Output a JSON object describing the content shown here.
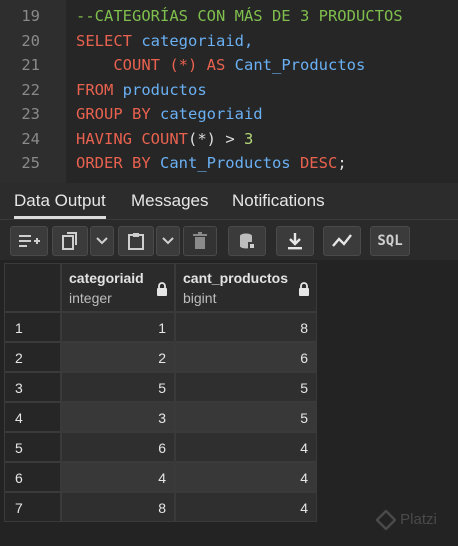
{
  "editor": {
    "lines": [
      {
        "n": "19",
        "tokens": [
          {
            "t": "--CATEGORÍAS CON MÁS DE 3 PRODUCTOS",
            "c": "cm"
          }
        ]
      },
      {
        "n": "20",
        "tokens": [
          {
            "t": "SELECT",
            "c": "kw"
          },
          {
            "t": " categoriaid,",
            "c": "id"
          }
        ]
      },
      {
        "n": "21",
        "tokens": [
          {
            "t": "    COUNT",
            "c": "kw"
          },
          {
            "t": " (*) ",
            "c": "kw"
          },
          {
            "t": "AS",
            "c": "kw"
          },
          {
            "t": " Cant_Productos",
            "c": "id"
          }
        ]
      },
      {
        "n": "22",
        "tokens": [
          {
            "t": "FROM",
            "c": "kw"
          },
          {
            "t": " productos",
            "c": "id"
          }
        ]
      },
      {
        "n": "23",
        "tokens": [
          {
            "t": "GROUP BY",
            "c": "kw"
          },
          {
            "t": " categoriaid",
            "c": "id"
          }
        ]
      },
      {
        "n": "24",
        "tokens": [
          {
            "t": "HAVING",
            "c": "kw"
          },
          {
            "t": " COUNT",
            "c": "kw"
          },
          {
            "t": "(*)",
            "c": "op"
          },
          {
            "t": " > ",
            "c": "op"
          },
          {
            "t": "3",
            "c": "num"
          }
        ]
      },
      {
        "n": "25",
        "tokens": [
          {
            "t": "ORDER BY",
            "c": "kw"
          },
          {
            "t": " Cant_Productos",
            "c": "id"
          },
          {
            "t": " DESC",
            "c": "kw"
          },
          {
            "t": ";",
            "c": "op"
          }
        ]
      }
    ]
  },
  "tabs": [
    "Data Output",
    "Messages",
    "Notifications"
  ],
  "toolbar": {
    "sql_label": "SQL",
    "icons": [
      "add-row-icon",
      "copy-icon",
      "dropdown-chevron-icon",
      "paste-icon",
      "dropdown-chevron-icon",
      "delete-icon",
      "save-data-icon",
      "download-icon",
      "graph-icon",
      "sql-icon"
    ]
  },
  "grid": {
    "columns": [
      {
        "name": "categoriaid",
        "type": "integer"
      },
      {
        "name": "cant_productos",
        "type": "bigint"
      }
    ],
    "rows": [
      {
        "n": "1",
        "a": "1",
        "b": "8"
      },
      {
        "n": "2",
        "a": "2",
        "b": "6"
      },
      {
        "n": "3",
        "a": "5",
        "b": "5"
      },
      {
        "n": "4",
        "a": "3",
        "b": "5"
      },
      {
        "n": "5",
        "a": "6",
        "b": "4"
      },
      {
        "n": "6",
        "a": "4",
        "b": "4"
      },
      {
        "n": "7",
        "a": "8",
        "b": "4"
      }
    ]
  },
  "watermark": "Platzi"
}
